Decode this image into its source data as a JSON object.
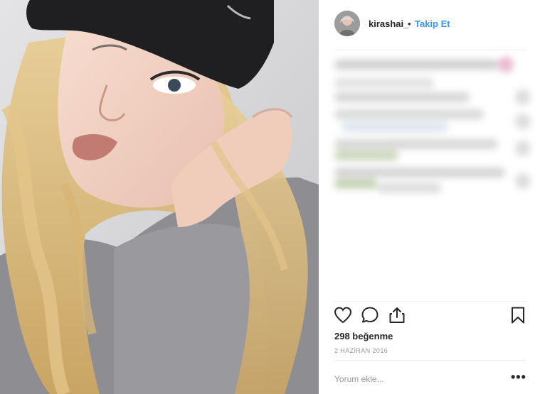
{
  "header": {
    "username": "kirashai_",
    "separator": "•",
    "follow_label": "Takip Et"
  },
  "actions": {
    "like_icon": "heart-icon",
    "comment_icon": "comment-icon",
    "share_icon": "share-icon",
    "save_icon": "bookmark-icon"
  },
  "likes_text": "298 beğenme",
  "date_text": "2 HAZİRAN 2016",
  "comment_placeholder": "Yorum ekle...",
  "more_label": "•••",
  "colors": {
    "accent": "#3897f0",
    "text": "#262626",
    "muted": "#999999",
    "divider": "#efefef"
  }
}
